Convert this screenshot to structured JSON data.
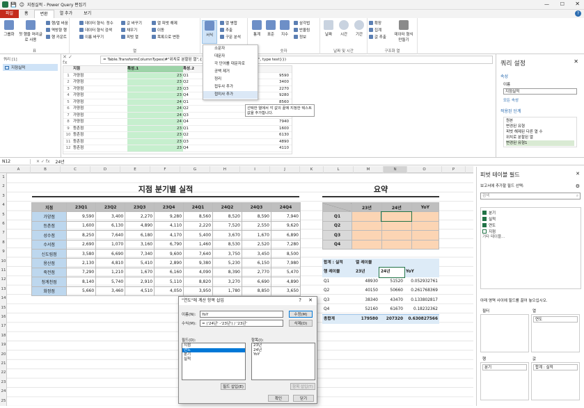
{
  "pq": {
    "title": "지점실적 - Power Query 편집기",
    "tabs": [
      "파일",
      "홈",
      "변환",
      "열 추가",
      "보기"
    ],
    "ribbon": {
      "groups": [
        "표",
        "열",
        "숫자",
        "날짜 및 시간",
        "구조화 열"
      ],
      "table_btns": {
        "group_by": "그룹화",
        "use_first_row": "첫 행을 머리글로 사용",
        "transpose": "행/열 바꿈",
        "reverse": "역방향 행",
        "count": "행 카운트"
      },
      "any_col": {
        "data_type": "데이터 형식: 정수",
        "detect": "데이터 형식 검색",
        "rename": "이름 바꾸기",
        "replace": "값 바꾸기",
        "fill": "채우기",
        "pivot": "피벗 열",
        "unpivot": "열 피벗 해제",
        "move": "이동",
        "to_list": "목록으로 변환"
      },
      "text": {
        "format": "서식",
        "merge": "열 병합",
        "extract": "추출",
        "parse": "구문 분석",
        "split": "열 분할"
      },
      "number": {
        "stats": "통계",
        "standard": "표준",
        "sci": "지수",
        "trig": "삼각법",
        "round": "반올림",
        "info": "정보"
      },
      "datetime": {
        "date": "날짜",
        "time": "시간",
        "duration": "기간"
      },
      "structured": {
        "expand": "확장",
        "aggregate": "집계",
        "extract_values": "값 추출",
        "run": "데이터 형식 만들기"
      }
    },
    "queries_header": "쿼리 [1]",
    "query_name": "지점실적",
    "formula": "= Table.TransformColumnTypes(#\"위치로 분할된 열\",{{\"특성.1\", type text}, {\"특성.2\", type text}})",
    "columns": [
      "지점",
      "특성.1",
      "특성.2",
      ""
    ],
    "rows": [
      [
        "1",
        "가양점",
        "23",
        "Q1",
        "9590"
      ],
      [
        "2",
        "가양점",
        "23",
        "Q2",
        "3400"
      ],
      [
        "3",
        "가양점",
        "23",
        "Q3",
        "2270"
      ],
      [
        "4",
        "가양점",
        "23",
        "Q4",
        "9280"
      ],
      [
        "5",
        "가양점",
        "24",
        "Q1",
        "8560"
      ],
      [
        "6",
        "가양점",
        "24",
        "Q2",
        "8520"
      ],
      [
        "7",
        "가양점",
        "24",
        "Q3",
        "8590"
      ],
      [
        "8",
        "가양점",
        "24",
        "Q4",
        "7940"
      ],
      [
        "9",
        "등촌점",
        "23",
        "Q1",
        "1600"
      ],
      [
        "10",
        "등촌점",
        "23",
        "Q2",
        "6130"
      ],
      [
        "11",
        "등촌점",
        "23",
        "Q3",
        "4890"
      ],
      [
        "12",
        "등촌점",
        "23",
        "Q4",
        "4110"
      ]
    ],
    "menu": [
      "소문자",
      "대문자",
      "각 단어를 대문자로",
      "공백 제거",
      "정리",
      "접두사 추가",
      "접미사 추가"
    ],
    "tooltip": "선택한 열에서 각 값의 끝에 지정한 텍스트 값을 추가합니다.",
    "settings": {
      "title": "쿼리 설정",
      "props": "속성",
      "name_label": "이름",
      "name_value": "지점실적",
      "all_props": "모든 속성",
      "steps_label": "적용된 단계",
      "steps": [
        "원본",
        "변경된 유형",
        "피벗 해제된 다른 열 수",
        "위치로 분할된 열",
        "변경된 유형1"
      ]
    }
  },
  "xl": {
    "namebox": "N12",
    "formula": "24년",
    "cols": [
      "A",
      "B",
      "C",
      "D",
      "E",
      "F",
      "G",
      "H",
      "I",
      "J",
      "K",
      "L",
      "M",
      "N",
      "O",
      "P"
    ],
    "title": "지점 분기별 실적",
    "summary_title": "요약",
    "table_headers": [
      "지점",
      "23Q1",
      "23Q2",
      "23Q3",
      "23Q4",
      "24Q1",
      "24Q2",
      "24Q3",
      "24Q4"
    ],
    "table_rows": [
      [
        "가양점",
        "9,590",
        "3,400",
        "2,270",
        "9,280",
        "8,560",
        "8,520",
        "8,590",
        "7,940"
      ],
      [
        "등촌점",
        "1,600",
        "6,130",
        "4,890",
        "4,110",
        "2,220",
        "7,520",
        "2,550",
        "9,620"
      ],
      [
        "성수점",
        "8,250",
        "7,640",
        "6,180",
        "4,170",
        "5,400",
        "3,670",
        "1,670",
        "6,890"
      ],
      [
        "수서점",
        "2,690",
        "1,070",
        "3,160",
        "6,790",
        "1,460",
        "8,530",
        "2,520",
        "7,280"
      ],
      [
        "신도림점",
        "3,580",
        "6,690",
        "7,340",
        "9,600",
        "7,640",
        "3,750",
        "3,450",
        "8,500"
      ],
      [
        "용산점",
        "2,130",
        "4,810",
        "5,410",
        "2,890",
        "9,380",
        "5,230",
        "6,150",
        "7,980"
      ],
      [
        "죽전점",
        "7,290",
        "1,210",
        "1,670",
        "6,160",
        "4,090",
        "8,390",
        "2,770",
        "5,470"
      ],
      [
        "청계천점",
        "8,140",
        "5,740",
        "2,910",
        "5,110",
        "8,820",
        "3,270",
        "6,690",
        "4,890"
      ],
      [
        "화정점",
        "5,660",
        "3,460",
        "4,510",
        "4,050",
        "3,950",
        "1,780",
        "8,850",
        "3,650"
      ]
    ],
    "summary_cols": [
      "23년",
      "24년",
      "YoY"
    ],
    "summary_rows": [
      "Q1",
      "Q2",
      "Q3",
      "Q4"
    ],
    "pivot": {
      "corner1": "합계 : 실적",
      "col_labels": "열 레이블",
      "row_labels": "행 레이블",
      "cols": [
        "23년",
        "24년",
        "YoY"
      ],
      "rows": [
        [
          "Q1",
          "48930",
          "51520",
          "0.052932761"
        ],
        [
          "Q2",
          "40150",
          "50660",
          "0.261768369"
        ],
        [
          "Q3",
          "38340",
          "43470",
          "0.133802817"
        ],
        [
          "Q4",
          "52160",
          "61670",
          "0.18232362"
        ]
      ],
      "total": [
        "총합계",
        "179580",
        "207320",
        "0.630827566"
      ]
    },
    "fields_pane": {
      "title": "피벗 테이블 필드",
      "choose": "보고서에 추가할 필드 선택:",
      "search": "검색",
      "fields": [
        "분기",
        "실적",
        "연도",
        "지점"
      ],
      "more": "기타 테이블...",
      "drag": "아래 영역 사이에 필드를 끌어 놓으십시오.",
      "filter": "필터",
      "columns": "열",
      "rows": "행",
      "values": "값",
      "col_value": "연도",
      "row_value": "분기",
      "val_value": "합계 : 실적"
    },
    "dialog": {
      "title": "\"연도\"에 계산 항목 삽입",
      "name_label": "이름(N):",
      "name_value": "YoY",
      "formula_label": "수식(M):",
      "formula_value": "= ('24년' -'23년') / '23년'",
      "modify": "수정(M)",
      "delete": "삭제(D)",
      "fields_label": "필드(D):",
      "items_label": "항목(I):",
      "fields": [
        "지점",
        "연도",
        "분기",
        "실적"
      ],
      "items": [
        "23년",
        "24년",
        "YoY"
      ],
      "insert_field": "필드 삽입(E)",
      "insert_item": "항목 삽입(T)",
      "ok": "확인",
      "close": "닫기"
    }
  }
}
